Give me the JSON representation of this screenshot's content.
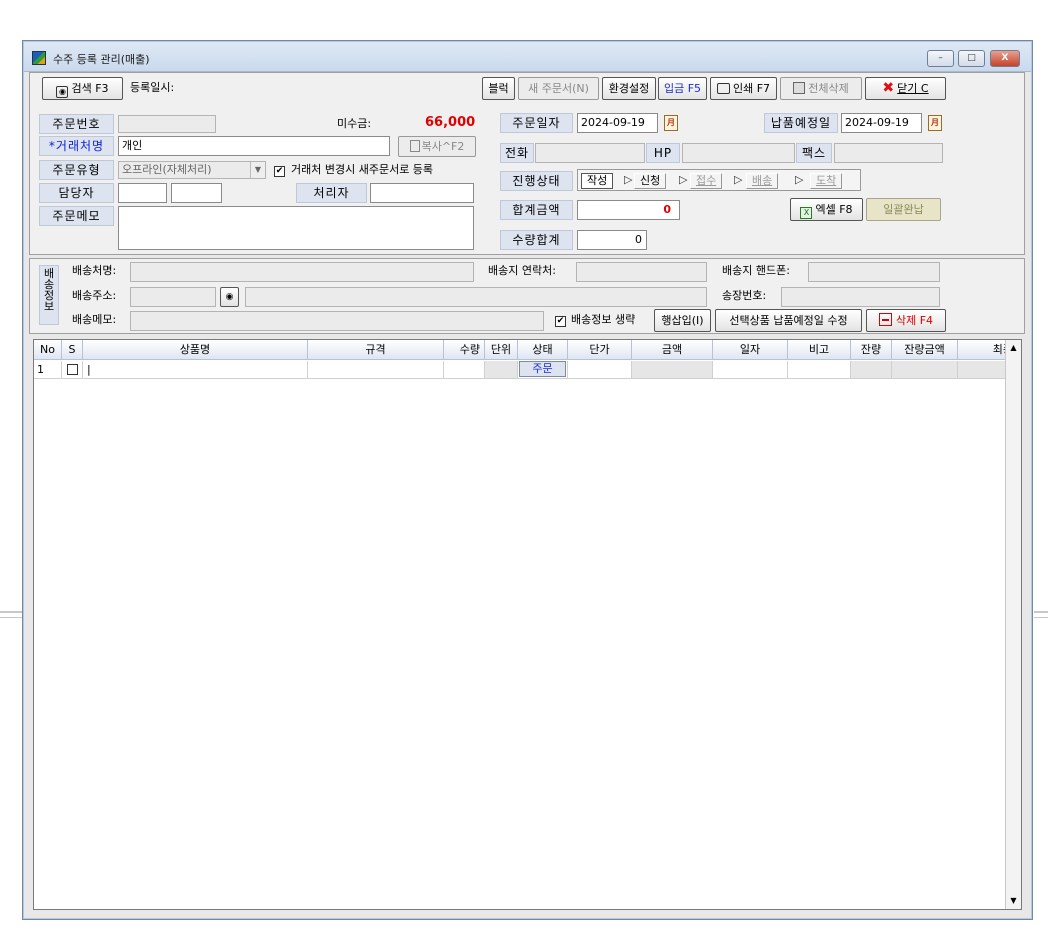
{
  "window": {
    "title": "수주 등록 관리(매출)",
    "minimize": "–",
    "maximize": "□",
    "close": "X"
  },
  "toolbar": {
    "search": "검색 F3",
    "reg_date_label": "등록일시:",
    "block": "블럭",
    "new_order": "새 주문서(N)",
    "env": "환경설정",
    "deposit": "입금 F5",
    "print": "인쇄 F7",
    "delete_all": "전체삭제",
    "close": "닫기 C"
  },
  "form": {
    "order_no_label": "주문번호",
    "order_no": "",
    "unpaid_label": "미수금:",
    "unpaid": "66,000",
    "customer_label": "*거래처명",
    "customer": "개인",
    "copy": "복사^F2",
    "order_type_label": "주문유형",
    "order_type": "오프라인(자체처리)",
    "new_on_change": "거래처 변경시 새주문서로 등록",
    "manager_label": "담당자",
    "handler_label": "처리자",
    "memo_label": "주문메모",
    "order_date_label": "주문일자",
    "order_date": "2024-09-19",
    "delivery_date_label": "납품예정일",
    "delivery_date": "2024-09-19",
    "cal_glyph": "月",
    "phone_label": "전화",
    "hp_label": "HP",
    "fax_label": "팩스",
    "progress_label": "진행상태",
    "steps": [
      "작성",
      "신청",
      "접수",
      "배송",
      "도착"
    ],
    "step_arrow": "▷",
    "total_label": "합계금액",
    "total": "0",
    "qty_total_label": "수량합계",
    "qty_total": "0",
    "excel": "엑셀 F8",
    "bulk_paid": "일괄완납"
  },
  "shipping": {
    "section_label": "배송정보",
    "name_label": "배송처명:",
    "contact_label": "배송지 연락처:",
    "mobile_label": "배송지 핸드폰:",
    "address_label": "배송주소:",
    "invoice_label": "송장번호:",
    "memo_label": "배송메모:",
    "omit": "배송정보 생략",
    "insert_row": "행삽입(I)",
    "edit_delivery": "선택상품 납품예정일 수정",
    "delete": "삭제 F4"
  },
  "grid": {
    "columns": [
      "No",
      "S",
      "상품명",
      "규격",
      "수량",
      "단위",
      "상태",
      "단가",
      "금액",
      "일자",
      "비고",
      "잔량",
      "잔량금액",
      "최종"
    ],
    "rows": [
      {
        "no": "1",
        "name": "|",
        "status": "주문"
      }
    ]
  }
}
